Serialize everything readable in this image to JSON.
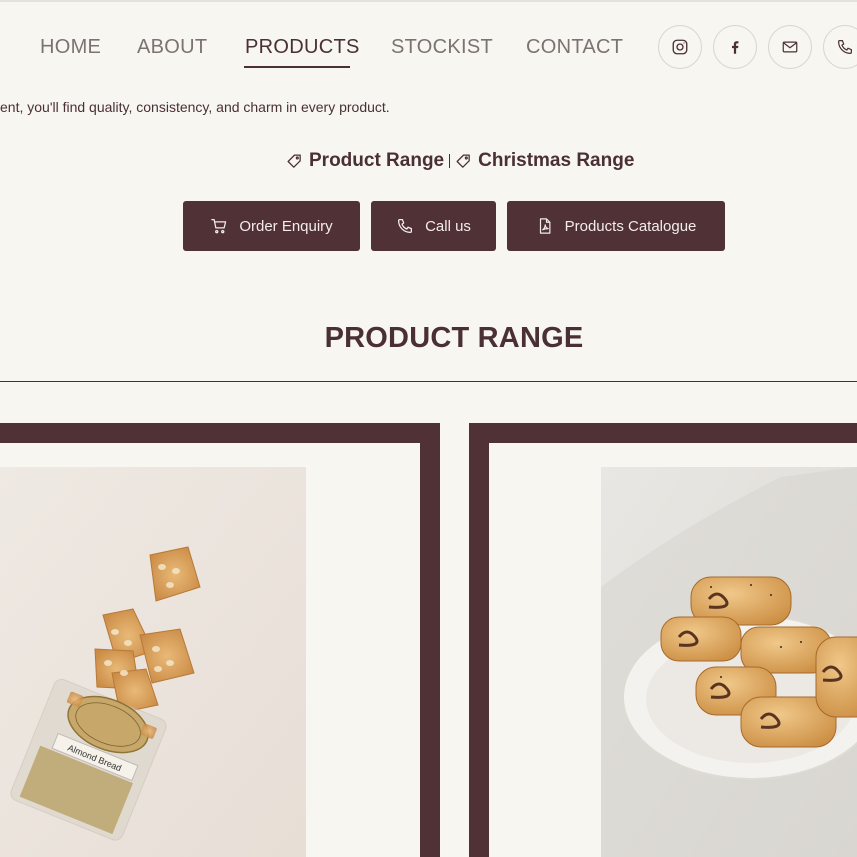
{
  "nav": {
    "items": [
      {
        "label": "HOME"
      },
      {
        "label": "ABOUT"
      },
      {
        "label": "PRODUCTS"
      },
      {
        "label": "STOCKIST"
      },
      {
        "label": "CONTACT"
      }
    ],
    "active": "PRODUCTS",
    "social": [
      "instagram-icon",
      "facebook-icon",
      "mail-icon",
      "phone-icon"
    ]
  },
  "intro_text": "ent, you'll find quality, consistency, and charm in every product.",
  "range_links": [
    {
      "label": "Product Range",
      "icon": "tag-icon"
    },
    {
      "label": "Christmas Range",
      "icon": "tag-icon"
    }
  ],
  "buttons": {
    "order": {
      "label": "Order Enquiry",
      "icon": "cart-icon"
    },
    "call": {
      "label": "Call us",
      "icon": "phone-icon"
    },
    "catalogue": {
      "label": "Products Catalogue",
      "icon": "pdf-icon"
    }
  },
  "section": {
    "title": "PRODUCT RANGE"
  },
  "colors": {
    "primary": "#4f3136",
    "background": "#f7f6f1",
    "nav_text": "#7d7272"
  },
  "products": [
    {
      "image": "almond-bread-photo",
      "packaging_text": "Almond Bread"
    },
    {
      "image": "nut-roll-pastries-photo"
    }
  ]
}
